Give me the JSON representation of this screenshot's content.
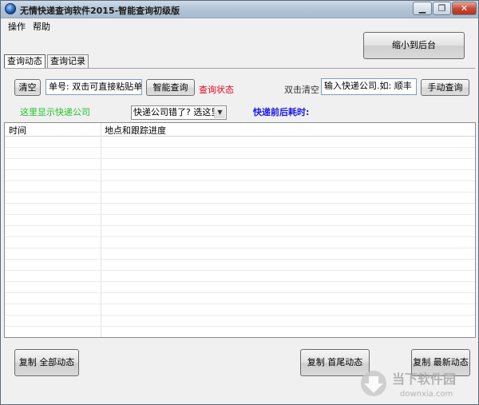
{
  "window": {
    "title": "无情快递查询软件2015-智能查询初级版",
    "controls": {
      "minimize": "▁",
      "restore": "❐",
      "close": "✕"
    }
  },
  "menu": [
    "操作",
    "帮助"
  ],
  "tabs": [
    "查询动态",
    "查询记录"
  ],
  "buttons": {
    "minimize_to_tray": "缩小到后台",
    "clear": "清空",
    "smart_query": "智能查询",
    "manual_query": "手动查询",
    "copy_all": "复制 全部动态",
    "copy_first_last": "复制 首尾动态",
    "copy_latest": "复制 最新动态"
  },
  "inputs": {
    "tracking_number": "单号: 双击可直接粘贴单号",
    "company": "输入快递公司.如: 顺丰"
  },
  "labels": {
    "query_status": "查询状态",
    "double_click_clear": "双击清空",
    "company_display": "这里显示快递公司",
    "time_elapsed": "快递前后耗时:"
  },
  "company_select": {
    "value": "快递公司错了? 选这里"
  },
  "table": {
    "columns": [
      "时间",
      "地点和跟踪进度"
    ],
    "rows": []
  },
  "watermark": {
    "site_name": "当下软件园",
    "url": "downxia.com"
  },
  "colors": {
    "status_red": "#e8001b",
    "company_green": "#1fc32b",
    "elapsed_blue": "#1717e6"
  }
}
